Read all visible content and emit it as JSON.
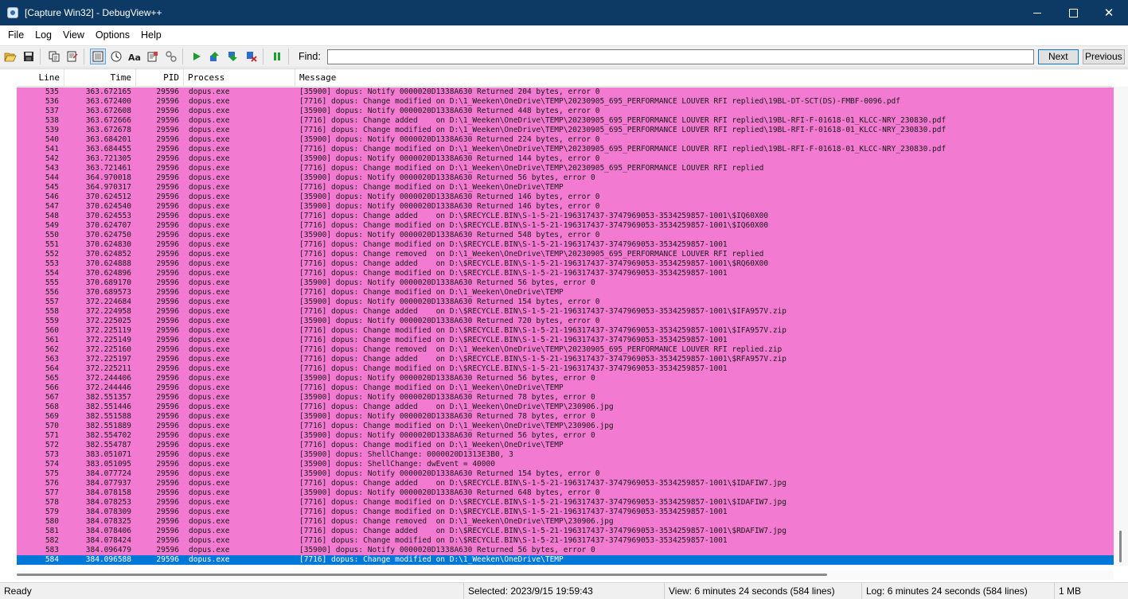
{
  "window": {
    "title": "[Capture Win32] - DebugView++",
    "minimize": "–",
    "maximize": "□",
    "close": "✕"
  },
  "menu": [
    "File",
    "Log",
    "View",
    "Options",
    "Help"
  ],
  "toolbar": {
    "find_label": "Find:",
    "find_value": "",
    "next_label": "Next",
    "previous_label": "Previous"
  },
  "columns": {
    "line": "Line",
    "time": "Time",
    "pid": "PID",
    "process": "Process",
    "message": "Message"
  },
  "rows": [
    {
      "line": "535",
      "time": "363.672165",
      "pid": "29596",
      "process": "dopus.exe",
      "message": "[35900] dopus: Notify 0000020D1338A630 Returned 204 bytes, error 0"
    },
    {
      "line": "536",
      "time": "363.672400",
      "pid": "29596",
      "process": "dopus.exe",
      "message": "[7716] dopus: Change modified on D:\\1_Weeken\\OneDrive\\TEMP\\20230905_695_PERFORMANCE LOUVER RFI replied\\19BL-DT-SCT(DS)-FMBF-0096.pdf"
    },
    {
      "line": "537",
      "time": "363.672608",
      "pid": "29596",
      "process": "dopus.exe",
      "message": "[35900] dopus: Notify 0000020D1338A630 Returned 448 bytes, error 0"
    },
    {
      "line": "538",
      "time": "363.672666",
      "pid": "29596",
      "process": "dopus.exe",
      "message": "[7716] dopus: Change added    on D:\\1_Weeken\\OneDrive\\TEMP\\20230905_695_PERFORMANCE LOUVER RFI replied\\19BL-RFI-F-01618-01_KLCC-NRY_230830.pdf"
    },
    {
      "line": "539",
      "time": "363.672678",
      "pid": "29596",
      "process": "dopus.exe",
      "message": "[7716] dopus: Change modified on D:\\1_Weeken\\OneDrive\\TEMP\\20230905_695_PERFORMANCE LOUVER RFI replied\\19BL-RFI-F-01618-01_KLCC-NRY_230830.pdf"
    },
    {
      "line": "540",
      "time": "363.684201",
      "pid": "29596",
      "process": "dopus.exe",
      "message": "[35900] dopus: Notify 0000020D1338A630 Returned 224 bytes, error 0"
    },
    {
      "line": "541",
      "time": "363.684455",
      "pid": "29596",
      "process": "dopus.exe",
      "message": "[7716] dopus: Change modified on D:\\1_Weeken\\OneDrive\\TEMP\\20230905_695_PERFORMANCE LOUVER RFI replied\\19BL-RFI-F-01618-01_KLCC-NRY_230830.pdf"
    },
    {
      "line": "542",
      "time": "363.721305",
      "pid": "29596",
      "process": "dopus.exe",
      "message": "[35900] dopus: Notify 0000020D1338A630 Returned 144 bytes, error 0"
    },
    {
      "line": "543",
      "time": "363.721461",
      "pid": "29596",
      "process": "dopus.exe",
      "message": "[7716] dopus: Change modified on D:\\1_Weeken\\OneDrive\\TEMP\\20230905_695_PERFORMANCE LOUVER RFI replied"
    },
    {
      "line": "544",
      "time": "364.970018",
      "pid": "29596",
      "process": "dopus.exe",
      "message": "[35900] dopus: Notify 0000020D1338A630 Returned 56 bytes, error 0"
    },
    {
      "line": "545",
      "time": "364.970317",
      "pid": "29596",
      "process": "dopus.exe",
      "message": "[7716] dopus: Change modified on D:\\1_Weeken\\OneDrive\\TEMP"
    },
    {
      "line": "546",
      "time": "370.624512",
      "pid": "29596",
      "process": "dopus.exe",
      "message": "[35900] dopus: Notify 0000020D1338A630 Returned 146 bytes, error 0"
    },
    {
      "line": "547",
      "time": "370.624540",
      "pid": "29596",
      "process": "dopus.exe",
      "message": "[35900] dopus: Notify 0000020D1338A630 Returned 146 bytes, error 0"
    },
    {
      "line": "548",
      "time": "370.624553",
      "pid": "29596",
      "process": "dopus.exe",
      "message": "[7716] dopus: Change added    on D:\\$RECYCLE.BIN\\S-1-5-21-196317437-3747969053-3534259857-1001\\$IQ60X00"
    },
    {
      "line": "549",
      "time": "370.624707",
      "pid": "29596",
      "process": "dopus.exe",
      "message": "[7716] dopus: Change modified on D:\\$RECYCLE.BIN\\S-1-5-21-196317437-3747969053-3534259857-1001\\$IQ60X00"
    },
    {
      "line": "550",
      "time": "370.624750",
      "pid": "29596",
      "process": "dopus.exe",
      "message": "[35900] dopus: Notify 0000020D1338A630 Returned 548 bytes, error 0"
    },
    {
      "line": "551",
      "time": "370.624830",
      "pid": "29596",
      "process": "dopus.exe",
      "message": "[7716] dopus: Change modified on D:\\$RECYCLE.BIN\\S-1-5-21-196317437-3747969053-3534259857-1001"
    },
    {
      "line": "552",
      "time": "370.624852",
      "pid": "29596",
      "process": "dopus.exe",
      "message": "[7716] dopus: Change removed  on D:\\1_Weeken\\OneDrive\\TEMP\\20230905_695_PERFORMANCE LOUVER RFI replied"
    },
    {
      "line": "553",
      "time": "370.624888",
      "pid": "29596",
      "process": "dopus.exe",
      "message": "[7716] dopus: Change added    on D:\\$RECYCLE.BIN\\S-1-5-21-196317437-3747969053-3534259857-1001\\$RQ60X00"
    },
    {
      "line": "554",
      "time": "370.624896",
      "pid": "29596",
      "process": "dopus.exe",
      "message": "[7716] dopus: Change modified on D:\\$RECYCLE.BIN\\S-1-5-21-196317437-3747969053-3534259857-1001"
    },
    {
      "line": "555",
      "time": "370.689170",
      "pid": "29596",
      "process": "dopus.exe",
      "message": "[35900] dopus: Notify 0000020D1338A630 Returned 56 bytes, error 0"
    },
    {
      "line": "556",
      "time": "370.689573",
      "pid": "29596",
      "process": "dopus.exe",
      "message": "[7716] dopus: Change modified on D:\\1_Weeken\\OneDrive\\TEMP"
    },
    {
      "line": "557",
      "time": "372.224684",
      "pid": "29596",
      "process": "dopus.exe",
      "message": "[35900] dopus: Notify 0000020D1338A630 Returned 154 bytes, error 0"
    },
    {
      "line": "558",
      "time": "372.224958",
      "pid": "29596",
      "process": "dopus.exe",
      "message": "[7716] dopus: Change added    on D:\\$RECYCLE.BIN\\S-1-5-21-196317437-3747969053-3534259857-1001\\$IFA957V.zip"
    },
    {
      "line": "559",
      "time": "372.225025",
      "pid": "29596",
      "process": "dopus.exe",
      "message": "[35900] dopus: Notify 0000020D1338A630 Returned 720 bytes, error 0"
    },
    {
      "line": "560",
      "time": "372.225119",
      "pid": "29596",
      "process": "dopus.exe",
      "message": "[7716] dopus: Change modified on D:\\$RECYCLE.BIN\\S-1-5-21-196317437-3747969053-3534259857-1001\\$IFA957V.zip"
    },
    {
      "line": "561",
      "time": "372.225149",
      "pid": "29596",
      "process": "dopus.exe",
      "message": "[7716] dopus: Change modified on D:\\$RECYCLE.BIN\\S-1-5-21-196317437-3747969053-3534259857-1001"
    },
    {
      "line": "562",
      "time": "372.225160",
      "pid": "29596",
      "process": "dopus.exe",
      "message": "[7716] dopus: Change removed  on D:\\1_Weeken\\OneDrive\\TEMP\\20230905_695_PERFORMANCE LOUVER RFI replied.zip"
    },
    {
      "line": "563",
      "time": "372.225197",
      "pid": "29596",
      "process": "dopus.exe",
      "message": "[7716] dopus: Change added    on D:\\$RECYCLE.BIN\\S-1-5-21-196317437-3747969053-3534259857-1001\\$RFA957V.zip"
    },
    {
      "line": "564",
      "time": "372.225211",
      "pid": "29596",
      "process": "dopus.exe",
      "message": "[7716] dopus: Change modified on D:\\$RECYCLE.BIN\\S-1-5-21-196317437-3747969053-3534259857-1001"
    },
    {
      "line": "565",
      "time": "372.244406",
      "pid": "29596",
      "process": "dopus.exe",
      "message": "[35900] dopus: Notify 0000020D1338A630 Returned 56 bytes, error 0"
    },
    {
      "line": "566",
      "time": "372.244446",
      "pid": "29596",
      "process": "dopus.exe",
      "message": "[7716] dopus: Change modified on D:\\1_Weeken\\OneDrive\\TEMP"
    },
    {
      "line": "567",
      "time": "382.551357",
      "pid": "29596",
      "process": "dopus.exe",
      "message": "[35900] dopus: Notify 0000020D1338A630 Returned 78 bytes, error 0"
    },
    {
      "line": "568",
      "time": "382.551446",
      "pid": "29596",
      "process": "dopus.exe",
      "message": "[7716] dopus: Change added    on D:\\1_Weeken\\OneDrive\\TEMP\\230906.jpg"
    },
    {
      "line": "569",
      "time": "382.551588",
      "pid": "29596",
      "process": "dopus.exe",
      "message": "[35900] dopus: Notify 0000020D1338A630 Returned 78 bytes, error 0"
    },
    {
      "line": "570",
      "time": "382.551889",
      "pid": "29596",
      "process": "dopus.exe",
      "message": "[7716] dopus: Change modified on D:\\1_Weeken\\OneDrive\\TEMP\\230906.jpg"
    },
    {
      "line": "571",
      "time": "382.554702",
      "pid": "29596",
      "process": "dopus.exe",
      "message": "[35900] dopus: Notify 0000020D1338A630 Returned 56 bytes, error 0"
    },
    {
      "line": "572",
      "time": "382.554787",
      "pid": "29596",
      "process": "dopus.exe",
      "message": "[7716] dopus: Change modified on D:\\1_Weeken\\OneDrive\\TEMP"
    },
    {
      "line": "573",
      "time": "383.051071",
      "pid": "29596",
      "process": "dopus.exe",
      "message": "[35900] dopus: ShellChange: 0000020D1313E3B0, 3"
    },
    {
      "line": "574",
      "time": "383.051095",
      "pid": "29596",
      "process": "dopus.exe",
      "message": "[35900] dopus: ShellChange: dwEvent = 40000"
    },
    {
      "line": "575",
      "time": "384.077724",
      "pid": "29596",
      "process": "dopus.exe",
      "message": "[35900] dopus: Notify 0000020D1338A630 Returned 154 bytes, error 0"
    },
    {
      "line": "576",
      "time": "384.077937",
      "pid": "29596",
      "process": "dopus.exe",
      "message": "[7716] dopus: Change added    on D:\\$RECYCLE.BIN\\S-1-5-21-196317437-3747969053-3534259857-1001\\$IDAFIW7.jpg"
    },
    {
      "line": "577",
      "time": "384.078158",
      "pid": "29596",
      "process": "dopus.exe",
      "message": "[35900] dopus: Notify 0000020D1338A630 Returned 648 bytes, error 0"
    },
    {
      "line": "578",
      "time": "384.078253",
      "pid": "29596",
      "process": "dopus.exe",
      "message": "[7716] dopus: Change modified on D:\\$RECYCLE.BIN\\S-1-5-21-196317437-3747969053-3534259857-1001\\$IDAFIW7.jpg"
    },
    {
      "line": "579",
      "time": "384.078309",
      "pid": "29596",
      "process": "dopus.exe",
      "message": "[7716] dopus: Change modified on D:\\$RECYCLE.BIN\\S-1-5-21-196317437-3747969053-3534259857-1001"
    },
    {
      "line": "580",
      "time": "384.078325",
      "pid": "29596",
      "process": "dopus.exe",
      "message": "[7716] dopus: Change removed  on D:\\1_Weeken\\OneDrive\\TEMP\\230906.jpg"
    },
    {
      "line": "581",
      "time": "384.078406",
      "pid": "29596",
      "process": "dopus.exe",
      "message": "[7716] dopus: Change added    on D:\\$RECYCLE.BIN\\S-1-5-21-196317437-3747969053-3534259857-1001\\$RDAFIW7.jpg"
    },
    {
      "line": "582",
      "time": "384.078424",
      "pid": "29596",
      "process": "dopus.exe",
      "message": "[7716] dopus: Change modified on D:\\$RECYCLE.BIN\\S-1-5-21-196317437-3747969053-3534259857-1001"
    },
    {
      "line": "583",
      "time": "384.096479",
      "pid": "29596",
      "process": "dopus.exe",
      "message": "[35900] dopus: Notify 0000020D1338A630 Returned 56 bytes, error 0"
    },
    {
      "line": "584",
      "time": "384.096588",
      "pid": "29596",
      "process": "dopus.exe",
      "message": "[7716] dopus: Change modified on D:\\1_Weeken\\OneDrive\\TEMP",
      "selected": true
    }
  ],
  "colors": {
    "row_highlight": "#f27ad1",
    "selection": "#0078d7",
    "titlebar": "#0c3a64"
  },
  "status": {
    "ready": "Ready",
    "selected": "Selected: 2023/9/15 19:59:43",
    "view": "View: 6 minutes 24 seconds (584 lines)",
    "log": "Log: 6 minutes 24 seconds (584 lines)",
    "memory": "1 MB"
  }
}
